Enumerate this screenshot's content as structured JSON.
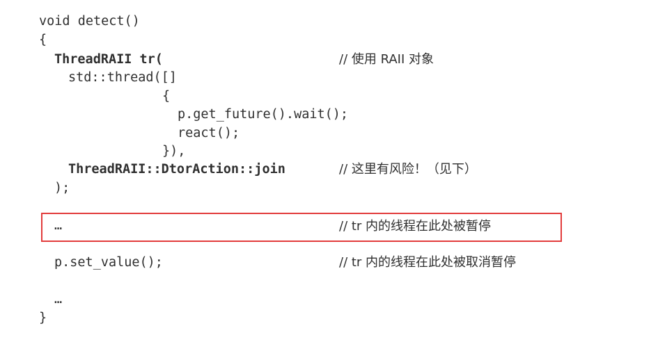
{
  "code_lines": [
    "void detect()",
    "{",
    "ThreadRAII tr(",
    "std::thread([]",
    "{",
    "p.get_future().wait();",
    "react();",
    "}),",
    "ThreadRAII::DtorAction::join",
    ");",
    "…",
    "p.set_value();",
    "…",
    "}"
  ],
  "comments": [
    "// 使用 RAII 对象",
    "// 这里有风险！（见下）",
    "// tr 内的线程在此处被暂停",
    "// tr 内的线程在此处被取消暂停"
  ],
  "highlight": {
    "color": "#e23b3b"
  }
}
